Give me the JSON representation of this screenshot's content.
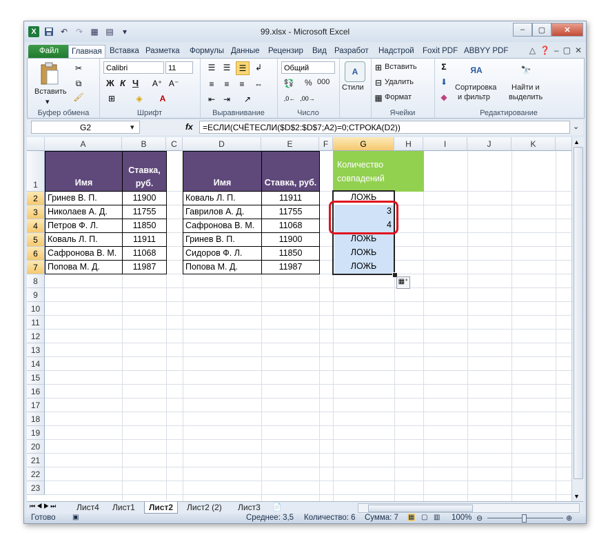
{
  "window": {
    "title": "99.xlsx - Microsoft Excel",
    "app_icon_letter": "X",
    "controls": [
      "–",
      "▢",
      "✕"
    ]
  },
  "tabs": [
    "Файл",
    "Главная",
    "Вставка",
    "Разметка",
    "Формулы",
    "Данные",
    "Рецензир",
    "Вид",
    "Разработ",
    "Надстрой",
    "Foxit PDF",
    "ABBYY PDF"
  ],
  "active_tab": "Главная",
  "ribbon": {
    "clipboard": {
      "label": "Буфер обмена",
      "paste": "Вставить"
    },
    "font": {
      "label": "Шрифт",
      "name": "Calibri",
      "size": "11",
      "bold": "Ж",
      "italic": "К",
      "underline": "Ч"
    },
    "alignment": {
      "label": "Выравнивание"
    },
    "number": {
      "label": "Число",
      "format": "Общий",
      "percent": "%",
      "thousands": "000"
    },
    "styles": {
      "label": "Стили"
    },
    "cells": {
      "label": "Ячейки",
      "insert": "Вставить",
      "delete": "Удалить",
      "format": "Формат"
    },
    "editing": {
      "label": "Редактирование",
      "sort_line1": "Сортировка",
      "sort_line2": "и фильтр",
      "find_line1": "Найти и",
      "find_line2": "выделить"
    }
  },
  "formula_bar": {
    "name_box": "G2",
    "fx": "fx",
    "formula": "=ЕСЛИ(СЧЁТЕСЛИ($D$2:$D$7;A2)=0;СТРОКА(D2))"
  },
  "columns": [
    "A",
    "B",
    "C",
    "D",
    "E",
    "F",
    "G",
    "H",
    "I",
    "J",
    "K"
  ],
  "rows": [
    "1",
    "2",
    "3",
    "4",
    "5",
    "6",
    "7",
    "8",
    "9",
    "10",
    "11",
    "12",
    "13",
    "14",
    "15",
    "16",
    "17",
    "18",
    "19",
    "20",
    "21",
    "22",
    "23"
  ],
  "table1": {
    "header_name": "Имя",
    "header_rate_line1": "Ставка,",
    "header_rate_line2": "руб.",
    "rows": [
      {
        "name": "Гринев В. П.",
        "rate": "11900"
      },
      {
        "name": "Николаев А. Д.",
        "rate": "11755"
      },
      {
        "name": "Петров Ф. Л.",
        "rate": "11850"
      },
      {
        "name": "Коваль Л. П.",
        "rate": "11911"
      },
      {
        "name": "Сафронова В. М.",
        "rate": "11068"
      },
      {
        "name": "Попова М. Д.",
        "rate": "11987"
      }
    ]
  },
  "table2": {
    "header_name": "Имя",
    "header_rate": "Ставка, руб.",
    "rows": [
      {
        "name": "Коваль Л. П.",
        "rate": "11911"
      },
      {
        "name": "Гаврилов А. Д.",
        "rate": "11755"
      },
      {
        "name": "Сафронова В. М.",
        "rate": "11068"
      },
      {
        "name": "Гринев В. П.",
        "rate": "11900"
      },
      {
        "name": "Сидоров Ф. Л.",
        "rate": "11850"
      },
      {
        "name": "Попова М. Д.",
        "rate": "11987"
      }
    ]
  },
  "match_column": {
    "header_line1": "Количество",
    "header_line2": "совпадений",
    "values": [
      "ЛОЖЬ",
      "3",
      "4",
      "ЛОЖЬ",
      "ЛОЖЬ",
      "ЛОЖЬ"
    ]
  },
  "sheets": [
    "Лист4",
    "Лист1",
    "Лист2",
    "Лист2 (2)",
    "Лист3"
  ],
  "active_sheet": "Лист2",
  "status": {
    "ready": "Готово",
    "average": "Среднее: 3,5",
    "count": "Количество: 6",
    "sum": "Сумма: 7",
    "zoom": "100%"
  },
  "colors": {
    "header_purple": "#5f497a",
    "header_green": "#92d050",
    "selection": "#cfe2f8",
    "highlight_red": "#e0121e"
  }
}
